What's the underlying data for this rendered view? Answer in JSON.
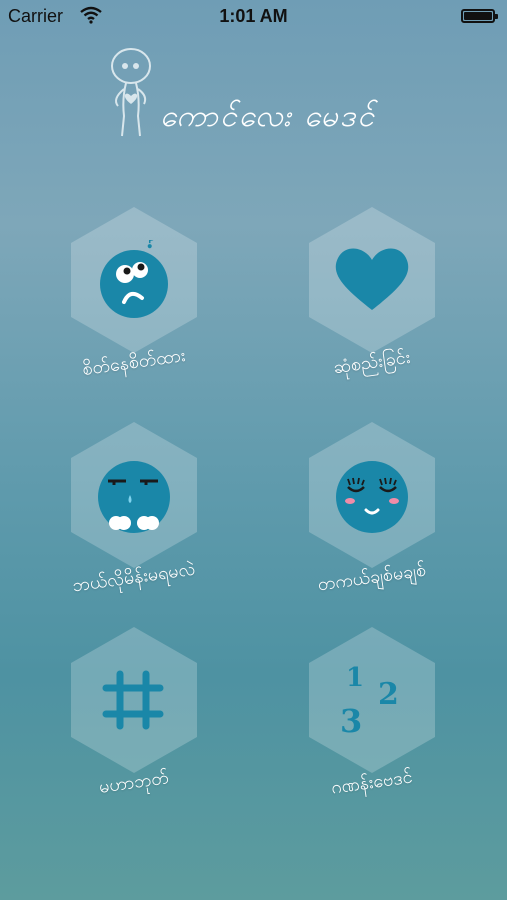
{
  "status_bar": {
    "carrier": "Carrier",
    "time": "1:01 AM"
  },
  "app": {
    "title": "ကောင်လေး မေဒင်"
  },
  "menu": [
    {
      "label": "စိတ်နေစိတ်ထား",
      "icon": "confused-face-icon"
    },
    {
      "label": "ဆုံစည်းခြင်း",
      "icon": "heart-icon"
    },
    {
      "label": "ဘယ်လိုမိန်းမရမလဲ",
      "icon": "crying-face-icon"
    },
    {
      "label": "တကယ်ချစ်မချစ်",
      "icon": "blushing-face-icon"
    },
    {
      "label": "မဟာဘုတ်",
      "icon": "hashtag-icon"
    },
    {
      "label": "ဂဏန်းဗေဒင်",
      "icon": "numbers-icon"
    }
  ],
  "number_icon": {
    "n1": "1",
    "n2": "2",
    "n3": "3"
  },
  "colors": {
    "icon_blue": "#1a87a8",
    "hex_fill": "rgba(255,255,255,0.22)"
  }
}
